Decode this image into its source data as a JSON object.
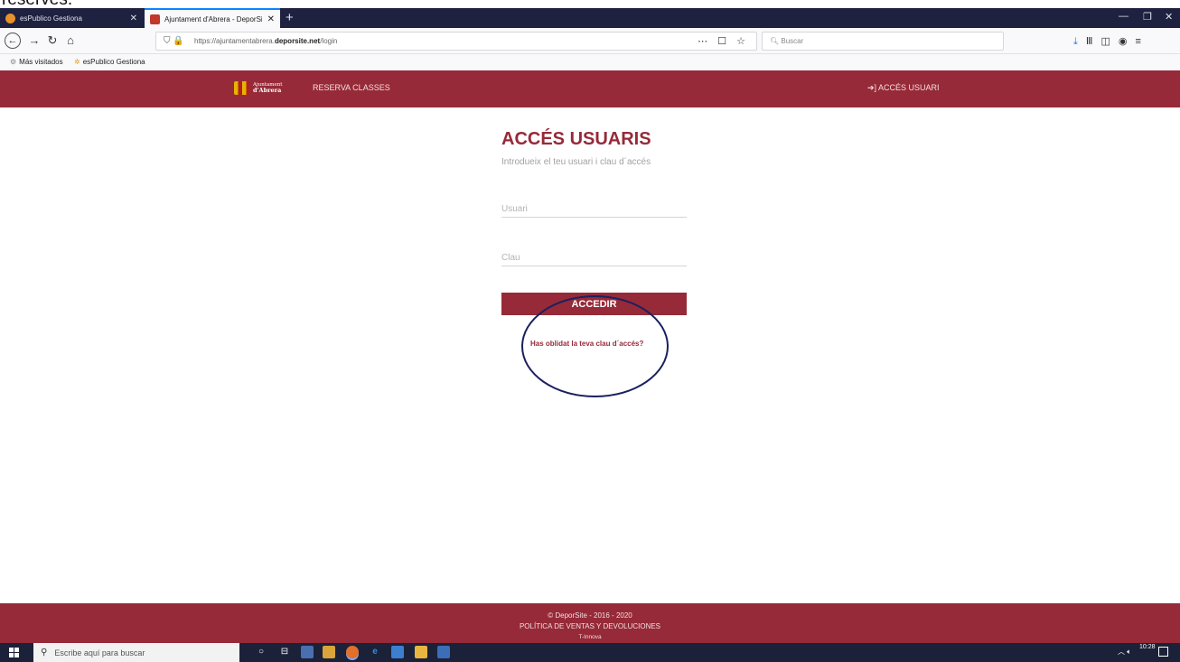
{
  "document_caption": "reserves.",
  "browser": {
    "tabs": [
      {
        "title": "esPublico Gestiona",
        "active": false
      },
      {
        "title": "Ajuntament d'Abrera - DeporSi",
        "active": true
      }
    ],
    "new_tab": "+",
    "url": {
      "prefix": "https://ajuntamentabrera.",
      "domain": "deporsite.net",
      "path": "/login"
    },
    "page_actions": "⋯ ☐ ☆",
    "search_placeholder": "Buscar",
    "bookmarks": [
      {
        "label": "Más visitados",
        "icon": "gear-icon"
      },
      {
        "label": "esPublico Gestiona",
        "icon": "espublico-icon"
      }
    ]
  },
  "site": {
    "logo": {
      "line1": "Ajuntament",
      "line2": "d'Abrera"
    },
    "nav": {
      "reserva": "RESERVA CLASSES",
      "acces": "ACCÉS USUARI"
    },
    "brand_color": "#962a38"
  },
  "login": {
    "title": "ACCÉS USUARIS",
    "subtitle": "Introdueix el teu usuari i clau d´accés",
    "user_placeholder": "Usuari",
    "password_placeholder": "Clau",
    "submit_label": "ACCEDIR",
    "forgot_link": "Has oblidat la teva clau d´accés?"
  },
  "footer": {
    "copyright": "© DeporSite - 2016 - 2020",
    "policy": "POLÍTICA DE VENTAS Y DEVOLUCIONES",
    "credit": "T-Innova"
  },
  "taskbar": {
    "search_placeholder": "Escribe aquí para buscar",
    "clock_time": "10:28"
  }
}
